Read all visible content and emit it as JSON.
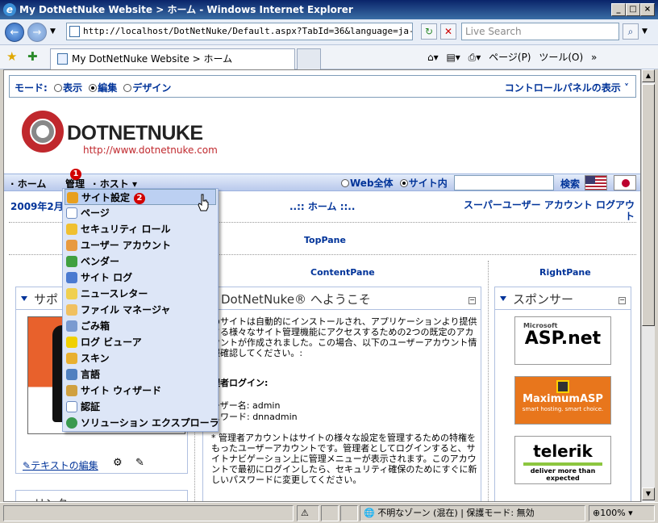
{
  "window": {
    "title": "My DotNetNuke Website > ホーム - Windows Internet Explorer"
  },
  "address": {
    "url": "http://localhost/DotNetNuke/Default.aspx?TabId=36&language=ja-JP"
  },
  "search": {
    "placeholder": "Live Search"
  },
  "tab": {
    "title": "My DotNetNuke Website > ホーム"
  },
  "toolbar": {
    "page": "ページ(P)",
    "tools": "ツール(O)"
  },
  "controlpanel": {
    "mode_label": "モード:",
    "modes": [
      "表示",
      "編集",
      "デザイン"
    ],
    "selected_mode": "編集",
    "show_panel": "コントロールパネルの表示"
  },
  "logo": {
    "name": "DOTNETNUKE",
    "url": "http://www.dotnetnuke.com"
  },
  "menu": {
    "items": [
      "ホーム",
      "管理",
      "ホスト"
    ],
    "badge1": "1",
    "badge2": "2",
    "search_scope": [
      "Web全体",
      "サイト内"
    ],
    "search_button": "検索"
  },
  "admin_menu": {
    "items": [
      "サイト設定",
      "ページ",
      "セキュリティ ロール",
      "ユーザー アカウント",
      "ベンダー",
      "サイト ログ",
      "ニュースレター",
      "ファイル マネージャ",
      "ごみ箱",
      "ログ ビューア",
      "スキン",
      "言語",
      "サイト ウィザード",
      "認証",
      "ソリューション エクスプローラ"
    ],
    "highlighted": "サイト設定"
  },
  "page": {
    "date": "2009年2月",
    "breadcrumb": "..:: ホーム ::..",
    "user_links": "スーパーユーザー アカウント ログアウト",
    "top_pane": "TopPane",
    "content_pane": "ContentPane",
    "right_pane": "RightPane",
    "left_module_title": "サポ",
    "left_edit": "テキストの編集",
    "left_link_title": "リンク",
    "welcome_title": "DotNetNuke® へようこそ",
    "welcome_p1": "のサイトは自動的にインストールされ、アプリケーションより提供さる様々なサイト管理機能にアクセスするための2つの既定のアカウントが作成されました。この場合、以下のユーザーアカウント情報確認してください。:",
    "admin_login": "理者ログイン:",
    "user_name": "ーザー名: admin",
    "password": "スワード: dnnadmin",
    "note": "* 管理者アカウントはサイトの様々な設定を管理するための特権をもったユーザーアカウントです。管理者としてログインすると、サイトナビゲーション上に管理メニューが表示されます。このアカウントで最初にログインしたら、セキュリティ確保のためにすぐに新しいパスワードに変更してください。",
    "sponsor_title": "スポンサー",
    "sponsors": [
      "ASP.net",
      "MaximumASP",
      "telerik"
    ],
    "sponsor_taglines": [
      "Microsoft",
      "smart hosting. smart choice.",
      "deliver more than expected"
    ]
  },
  "status": {
    "zone": "不明なゾーン (混在) | 保護モード: 無効",
    "zoom": "100%"
  }
}
